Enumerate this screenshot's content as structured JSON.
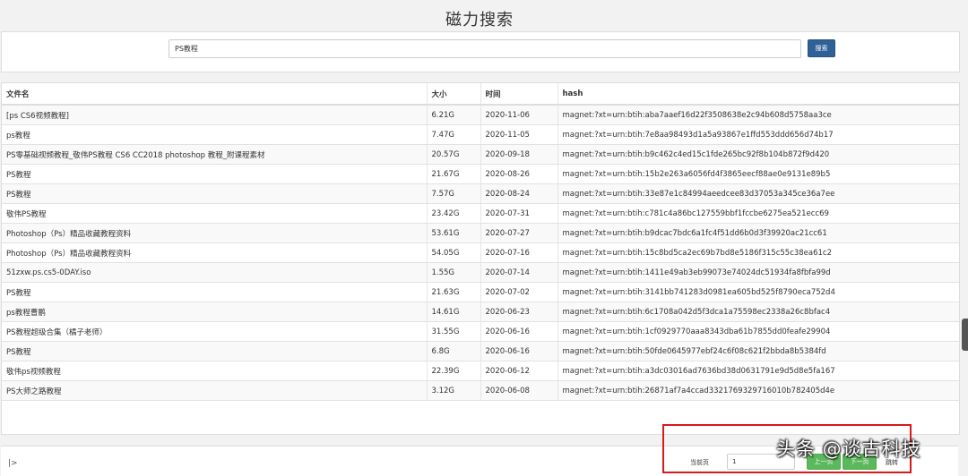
{
  "page": {
    "title": "磁力搜索"
  },
  "search": {
    "value": "PS教程",
    "button_label": "搜索"
  },
  "table": {
    "headers": [
      "文件名",
      "大小",
      "时间",
      "hash"
    ],
    "rows": [
      {
        "name": "[ps CS6视频教程]",
        "size": "6.21G",
        "date": "2020-11-06",
        "hash": "magnet:?xt=urn:btih:aba7aaef16d22f3508638e2c94b608d5758aa3ce"
      },
      {
        "name": "ps教程",
        "size": "7.47G",
        "date": "2020-11-05",
        "hash": "magnet:?xt=urn:btih:7e8aa98493d1a5a93867e1ffd553ddd656d74b17"
      },
      {
        "name": "PS零基础视频教程_敬伟PS教程 CS6 CC2018 photoshop 教程_附课程素材",
        "size": "20.57G",
        "date": "2020-09-18",
        "hash": "magnet:?xt=urn:btih:b9c462c4ed15c1fde265bc92f8b104b872f9d420"
      },
      {
        "name": "PS教程",
        "size": "21.67G",
        "date": "2020-08-26",
        "hash": "magnet:?xt=urn:btih:15b2e263a6056fd4f3865eecf88ae0e9131e89b5"
      },
      {
        "name": "PS教程",
        "size": "7.57G",
        "date": "2020-08-24",
        "hash": "magnet:?xt=urn:btih:33e87e1c84994aeedcee83d37053a345ce36a7ee"
      },
      {
        "name": "敬伟PS教程",
        "size": "23.42G",
        "date": "2020-07-31",
        "hash": "magnet:?xt=urn:btih:c781c4a86bc127559bbf1fccbe6275ea521ecc69"
      },
      {
        "name": "Photoshop（Ps）精品收藏教程资料",
        "size": "53.61G",
        "date": "2020-07-27",
        "hash": "magnet:?xt=urn:btih:b9dcac7bdc6a1fc4f51dd6b0d3f39920ac21cc61"
      },
      {
        "name": "Photoshop（Ps）精品收藏教程资料",
        "size": "54.05G",
        "date": "2020-07-16",
        "hash": "magnet:?xt=urn:btih:15c8bd5ca2ec69b7bd8e5186f315c55c38ea61c2"
      },
      {
        "name": " 51zxw.ps.cs5-0DAY.iso",
        "size": "1.55G",
        "date": "2020-07-14",
        "hash": "magnet:?xt=urn:btih:1411e49ab3eb99073e74024dc51934fa8fbfa99d"
      },
      {
        "name": "PS教程",
        "size": "21.63G",
        "date": "2020-07-02",
        "hash": "magnet:?xt=urn:btih:3141bb741283d0981ea605bd525f8790eca752d4"
      },
      {
        "name": "ps教程曹鹏",
        "size": "14.61G",
        "date": "2020-06-23",
        "hash": "magnet:?xt=urn:btih:6c1708a042d5f3dca1a75598ec2338a26c8bfac4"
      },
      {
        "name": "PS教程超级合集（橘子老师）",
        "size": "31.55G",
        "date": "2020-06-16",
        "hash": "magnet:?xt=urn:btih:1cf0929770aaa8343dba61b7855dd0feafe29904"
      },
      {
        "name": "PS教程",
        "size": "6.8G",
        "date": "2020-06-16",
        "hash": "magnet:?xt=urn:btih:50fde0645977ebf24c6f08c621f2bbda8b5384fd"
      },
      {
        "name": "敬伟ps视频教程",
        "size": "22.39G",
        "date": "2020-06-12",
        "hash": "magnet:?xt=urn:btih:a3dc03016ad7636bd38d0631791e9d5d8e5fa167"
      },
      {
        "name": "PS大师之路教程",
        "size": "3.12G",
        "date": "2020-06-08",
        "hash": "magnet:?xt=urn:btih:26871af7a4ccad3321769329716010b782405d4e"
      }
    ]
  },
  "pager": {
    "current_label": "当前页",
    "current_value": "1",
    "prev_label": "上一页",
    "next_label": "下一页",
    "jump_label": "跳转"
  },
  "footer": {
    "expand_glyph": "|>"
  },
  "watermark": {
    "text": "头条 @谈古科技"
  },
  "colors": {
    "primary_button": "#2f6197",
    "pager_button": "#5cb85c",
    "highlight_box": "#d9191c"
  }
}
